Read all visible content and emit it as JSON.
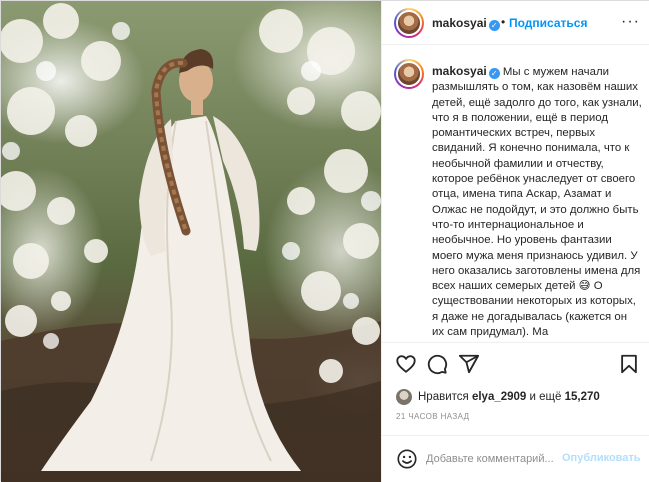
{
  "colors": {
    "accent": "#0095f6",
    "publish_disabled": "#b2dffc",
    "text": "#262626",
    "muted": "#8e8e8e",
    "border": "#efefef"
  },
  "photo": {
    "description_icon": "post-photo"
  },
  "header": {
    "username": "makosyai",
    "verified_icon": "verified-badge-icon",
    "separator": "•",
    "follow_label": "Подписаться",
    "more_label": "···"
  },
  "caption": {
    "username": "makosyai",
    "text": "Мы с мужем начали размышлять о том, как назовём наших детей, ещё задолго до того, как узнали, что я в положении, ещё в период романтических встреч, первых свиданий. Я конечно понимала, что к необычной фамилии и отчеству, которое ребёнок унаследует от своего отца, имена типа Аскар, Азамат и Олжас не подойдут, и это должно быть что-то интернациональное и необычное. Но уровень фантазии моего мужа меня признаюсь удивил. У него оказались заготовлены имена для всех наших семерых детей 😅 О существовании некоторых из которых, я даже не догадывалась (кажется он их сам придумал). Ма"
  },
  "actions": {
    "like_icon": "heart-icon",
    "comment_icon": "comment-icon",
    "share_icon": "share-icon",
    "save_icon": "bookmark-icon"
  },
  "likes": {
    "prefix": "Нравится ",
    "user": "elya_2909",
    "middle": " и ещё ",
    "count": "15,270"
  },
  "timestamp": "21 часов назад",
  "comment": {
    "placeholder": "Добавьте комментарий...",
    "publish_label": "Опубликовать",
    "emoji_icon": "smiley-icon"
  }
}
